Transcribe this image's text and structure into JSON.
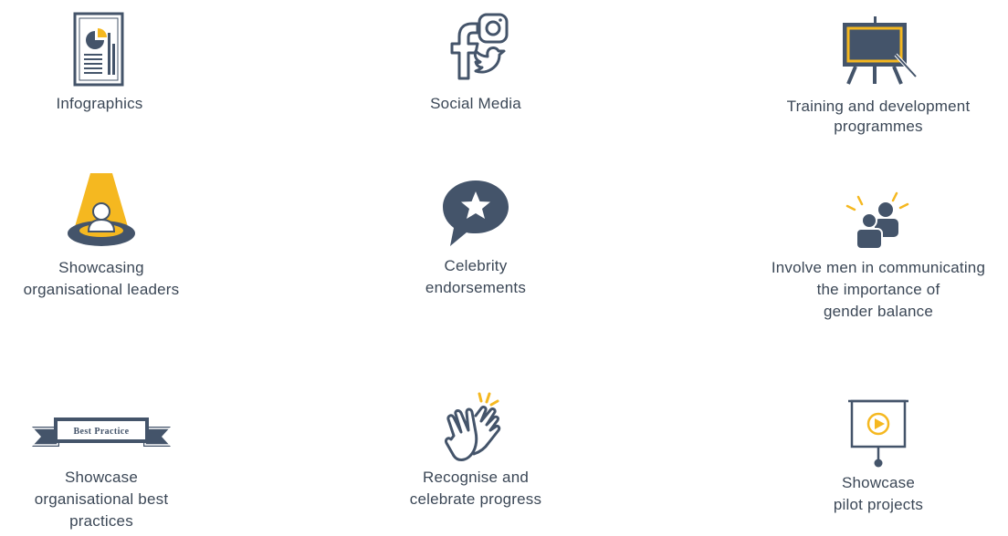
{
  "colors": {
    "slate": "#44546a",
    "accent": "#f5b820",
    "text": "#3b4756"
  },
  "items": [
    {
      "icon": "infographic-icon",
      "lines": [
        "Infographics"
      ]
    },
    {
      "icon": "social-media-icon",
      "lines": [
        "Social Media"
      ]
    },
    {
      "icon": "training-easel-icon",
      "lines": [
        "Training and development",
        "programmes"
      ]
    },
    {
      "icon": "spotlight-leader-icon",
      "lines": [
        "Showcasing",
        "organisational leaders"
      ]
    },
    {
      "icon": "star-speech-bubble-icon",
      "lines": [
        "Celebrity",
        "endorsements"
      ]
    },
    {
      "icon": "people-communicating-icon",
      "lines": [
        "Involve men in communicating",
        "the importance of",
        "gender balance"
      ]
    },
    {
      "icon": "best-practice-ribbon-icon",
      "ribbon_text": "Best Practice",
      "lines": [
        "Showcase",
        "organisational best",
        "practices"
      ]
    },
    {
      "icon": "clapping-hands-icon",
      "lines": [
        "Recognise and",
        "celebrate progress"
      ]
    },
    {
      "icon": "presentation-screen-icon",
      "lines": [
        "Showcase",
        "pilot projects"
      ]
    }
  ]
}
